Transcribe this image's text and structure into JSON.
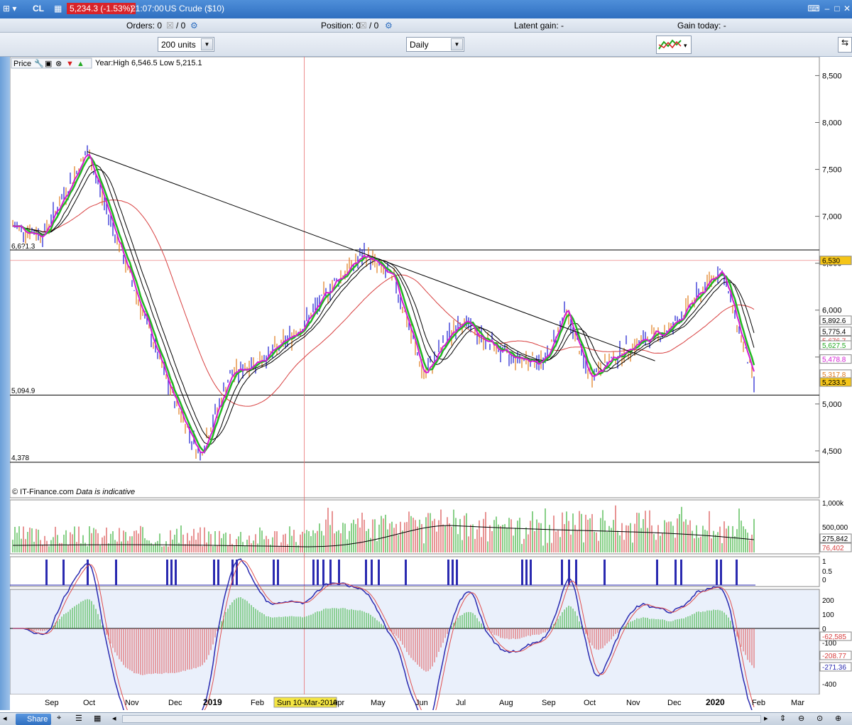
{
  "titlebar": {
    "symbol": "CL",
    "price_change": "5,234.3 (-1.53%)",
    "time": "21:07:00",
    "instrument": "US Crude ($10)"
  },
  "infobar": {
    "orders_label": "Orders: 0",
    "orders_sep": "/ 0",
    "position_label": "Position: 0",
    "position_sep": "/ 0",
    "latent_gain": "Latent gain: -",
    "gain_today": "Gain today: -"
  },
  "toolbar": {
    "units_value": "200 units",
    "period_value": "Daily"
  },
  "price_panel": {
    "label": "Price",
    "year_info": "Year:High 6,546.5 Low 5,215.1",
    "copyright": "© IT-Finance.com",
    "disclaimer": "Data is indicative",
    "level_labels": [
      "6,6?1.3",
      "5,094.9",
      "4,378"
    ]
  },
  "axis": {
    "price_ticks": [
      "8,500",
      "8,000",
      "7,500",
      "7,000",
      "6,500",
      "6,000",
      "5,500",
      "5,000",
      "4,500"
    ],
    "price_badges": [
      {
        "text": "6,530",
        "color": "#f5c518"
      },
      {
        "text": "5,892.6",
        "color": "#ffffff"
      },
      {
        "text": "5,775.4",
        "color": "#ffffff"
      },
      {
        "text": "5,676.7",
        "color": "#ffffff"
      },
      {
        "text": "5,627.5",
        "color": "#ffffff"
      },
      {
        "text": "5,478.8",
        "color": "#ffffff"
      },
      {
        "text": "5,317.8",
        "color": "#ffffff"
      },
      {
        "text": "5,233.5",
        "color": "#f5c518"
      }
    ],
    "volume_ticks": [
      "1,000k",
      "500,000"
    ],
    "volume_badges": [
      "275,842",
      "76,402"
    ],
    "signal_ticks": [
      "1",
      "0.5",
      "0"
    ],
    "macd_ticks": [
      "200",
      "100",
      "0",
      "-100",
      "-400"
    ],
    "macd_badges": [
      "-62,585",
      "-208.77",
      "-271.36"
    ],
    "date_labels": [
      "Sep",
      "Oct",
      "Nov",
      "Dec",
      "2019",
      "Feb",
      "Sun 10-Mar-2019",
      "Apr",
      "May",
      "Jun",
      "Jul",
      "Aug",
      "Sep",
      "Oct",
      "Nov",
      "Dec",
      "2020",
      "Feb",
      "Mar"
    ]
  },
  "bottombar": {
    "share_label": "Share"
  },
  "colors": {
    "accent": "#2f6fc0",
    "up_bar": "#1a1ad0",
    "down_bar": "#e07a1a",
    "ema_fast": "#d41ad4",
    "ema_mid": "#22b822",
    "sma_long": "#d84040",
    "badge_yellow": "#f5c518"
  },
  "chart_data": {
    "type": "line",
    "title": "US Crude ($10) — Daily",
    "x": [
      "2018-08-10",
      "2018-09-01",
      "2018-10-03",
      "2018-11-01",
      "2018-12-01",
      "2018-12-24",
      "2019-01-15",
      "2019-02-15",
      "2019-03-10",
      "2019-04-01",
      "2019-04-23",
      "2019-05-15",
      "2019-06-05",
      "2019-07-01",
      "2019-08-05",
      "2019-09-01",
      "2019-09-16",
      "2019-10-03",
      "2019-11-01",
      "2019-12-01",
      "2020-01-07",
      "2020-01-31"
    ],
    "series": [
      {
        "name": "price",
        "values": [
          6900,
          6800,
          7690,
          6450,
          5200,
          4450,
          5300,
          5550,
          5850,
          6300,
          6600,
          6300,
          5300,
          5900,
          5500,
          5450,
          6000,
          5300,
          5600,
          5800,
          6450,
          5230
        ]
      }
    ],
    "horizontal_levels": [
      6641.3,
      6530,
      5094.9,
      4378
    ],
    "ylim": [
      4000,
      8700
    ],
    "year_high": 6546.5,
    "year_low": 5215.1,
    "last_price": 5234.3,
    "change_pct": -1.53
  }
}
